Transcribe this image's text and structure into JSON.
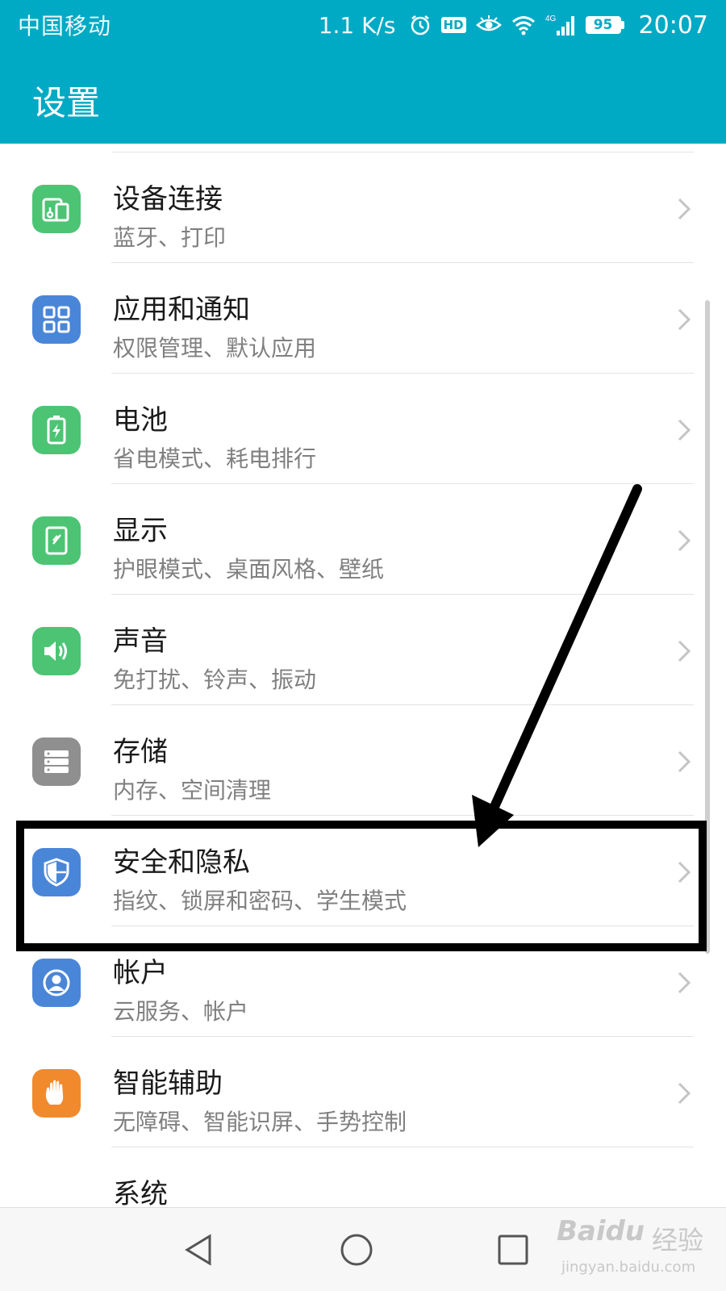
{
  "status_bar": {
    "carrier": "中国移动",
    "speed": "1.1 K/s",
    "hd": "HD",
    "network": "4G",
    "battery": "95",
    "time": "20:07"
  },
  "app_bar": {
    "title": "设置"
  },
  "items": [
    {
      "title": "设备连接",
      "subtitle": "蓝牙、打印",
      "icon": "device-connection-icon",
      "color": "#4cc474"
    },
    {
      "title": "应用和通知",
      "subtitle": "权限管理、默认应用",
      "icon": "apps-grid-icon",
      "color": "#4a86d8"
    },
    {
      "title": "电池",
      "subtitle": "省电模式、耗电排行",
      "icon": "battery-icon",
      "color": "#4cc474"
    },
    {
      "title": "显示",
      "subtitle": "护眼模式、桌面风格、壁纸",
      "icon": "display-icon",
      "color": "#4cc474"
    },
    {
      "title": "声音",
      "subtitle": "免打扰、铃声、振动",
      "icon": "sound-icon",
      "color": "#4cc474"
    },
    {
      "title": "存储",
      "subtitle": "内存、空间清理",
      "icon": "storage-icon",
      "color": "#8f8f8f"
    },
    {
      "title": "安全和隐私",
      "subtitle": "指纹、锁屏和密码、学生模式",
      "icon": "shield-icon",
      "color": "#4a86d8"
    },
    {
      "title": "帐户",
      "subtitle": "云服务、帐户",
      "icon": "account-icon",
      "color": "#4a86d8"
    },
    {
      "title": "智能辅助",
      "subtitle": "无障碍、智能识屏、手势控制",
      "icon": "hand-icon",
      "color": "#f08a2c"
    },
    {
      "title": "系统",
      "subtitle": "",
      "icon": "",
      "color": ""
    }
  ],
  "watermark": {
    "logo": "Baidu",
    "label": "经验",
    "url": "jingyan.baidu.com"
  }
}
